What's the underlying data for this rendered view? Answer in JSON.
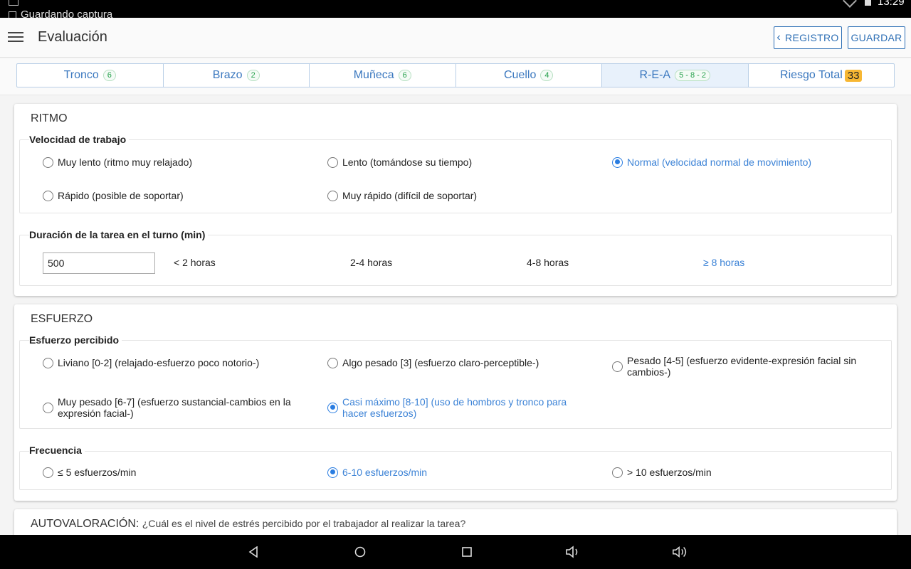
{
  "status_bar": {
    "notification": "Guardando captura",
    "time": "13:29"
  },
  "app_bar": {
    "title": "Evaluación",
    "registro_label": "REGISTRO",
    "guardar_label": "GUARDAR"
  },
  "tabs": [
    {
      "label": "Tronco",
      "badge": "6"
    },
    {
      "label": "Brazo",
      "badge": "2"
    },
    {
      "label": "Muñeca",
      "badge": "6"
    },
    {
      "label": "Cuello",
      "badge": "4"
    },
    {
      "label": "R-E-A",
      "badge": "5 - 8 - 2",
      "active": true
    },
    {
      "label": "Riesgo Total",
      "badge": "33"
    }
  ],
  "ritmo": {
    "title": "RITMO",
    "velocidad": {
      "legend": "Velocidad de trabajo",
      "options": [
        "Muy lento (ritmo muy relajado)",
        "Lento (tomándose su tiempo)",
        "Normal (velocidad normal de movimiento)",
        "Rápido (posible de soportar)",
        "Muy rápido (difícil de soportar)"
      ],
      "selected": "Normal (velocidad normal de movimiento)"
    },
    "duracion": {
      "legend": "Duración de la tarea en el turno (min)",
      "value": "500",
      "ranges": [
        "< 2 horas",
        "2-4 horas",
        "4-8 horas",
        "≥ 8 horas"
      ],
      "active_range": "≥ 8 horas"
    }
  },
  "esfuerzo": {
    "title": "ESFUERZO",
    "percibido": {
      "legend": "Esfuerzo percibido",
      "options": [
        "Liviano [0-2] (relajado-esfuerzo poco notorio-)",
        "Algo pesado [3] (esfuerzo claro-perceptible-)",
        "Pesado [4-5] (esfuerzo evidente-expresión facial sin cambios-)",
        "Muy pesado [6-7] (esfuerzo sustancial-cambios en la expresión facial-)",
        "Casi máximo [8-10] (uso de hombros y tronco para hacer esfuerzos)"
      ],
      "selected": "Casi máximo [8-10] (uso de hombros y tronco para hacer esfuerzos)"
    },
    "frecuencia": {
      "legend": "Frecuencia",
      "options": [
        "≤ 5 esfuerzos/min",
        "6-10 esfuerzos/min",
        "> 10 esfuerzos/min"
      ],
      "selected": "6-10 esfuerzos/min"
    }
  },
  "autovaloracion": {
    "title": "AUTOVALORACIÓN:",
    "question": "¿Cuál es el nivel de estrés percibido por el trabajador al realizar la tarea?"
  },
  "colors": {
    "accent": "#2e6fb5",
    "selected": "#2a7de1",
    "badge_green": "#24a04a",
    "badge_total": "#f7b733"
  },
  "icons": [
    "menu-icon",
    "chevron-left-icon",
    "back-icon",
    "home-icon",
    "recents-icon",
    "volume-down-icon",
    "volume-up-icon"
  ]
}
